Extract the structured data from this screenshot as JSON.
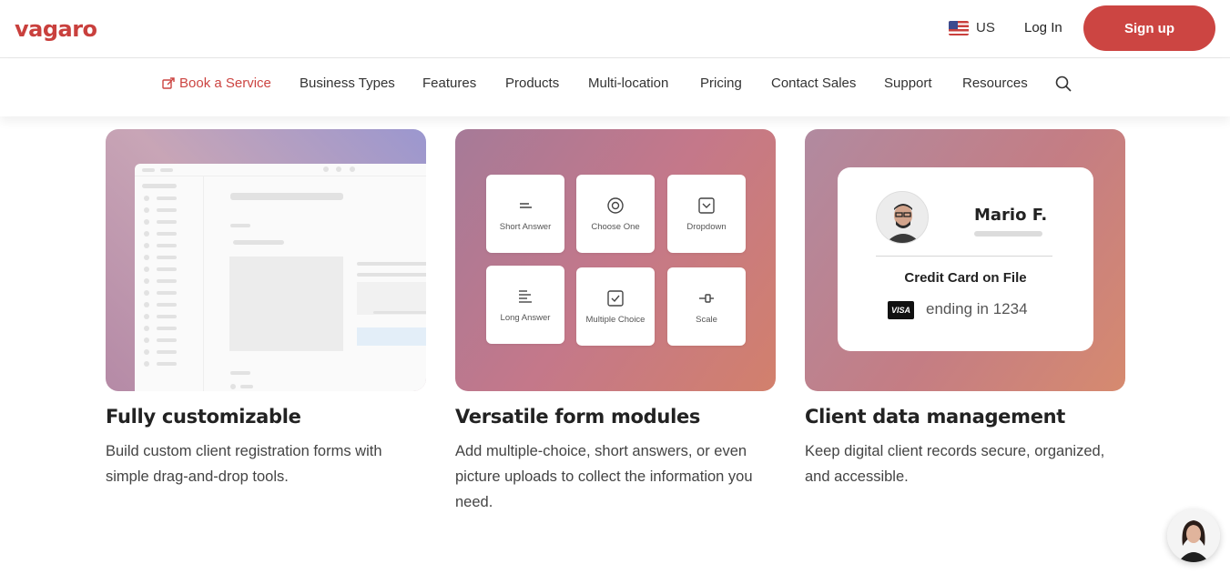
{
  "header": {
    "logo": "vagaro",
    "locale_label": "US",
    "login_label": "Log In",
    "signup_label": "Sign up"
  },
  "nav": {
    "items": [
      {
        "label": "Book a Service"
      },
      {
        "label": "Business Types"
      },
      {
        "label": "Features"
      },
      {
        "label": "Products"
      },
      {
        "label": "Multi-location"
      },
      {
        "label": "Pricing"
      },
      {
        "label": "Contact Sales"
      },
      {
        "label": "Support"
      },
      {
        "label": "Resources"
      }
    ]
  },
  "cards": [
    {
      "title": "Fully customizable",
      "description": "Build custom client registration forms with simple drag-and-drop tools."
    },
    {
      "title": "Versatile form modules",
      "description": "Add multiple-choice, short answers, or even picture uploads to collect the information you need.",
      "modules": [
        {
          "label": "Short Answer",
          "icon": "short-answer-icon"
        },
        {
          "label": "Choose One",
          "icon": "radio-icon"
        },
        {
          "label": "Dropdown",
          "icon": "dropdown-icon"
        },
        {
          "label": "Long Answer",
          "icon": "long-answer-icon"
        },
        {
          "label": "Multiple Choice",
          "icon": "checkbox-icon"
        },
        {
          "label": "Scale",
          "icon": "scale-icon"
        }
      ]
    },
    {
      "title": "Client data management",
      "description": "Keep digital client records secure, organized, and accessible.",
      "client": {
        "name": "Mario F.",
        "credit_label": "Credit Card on File",
        "card_brand": "VISA",
        "ending": "ending in 1234"
      }
    }
  ],
  "colors": {
    "brand": "#cc4542",
    "text": "#333333"
  }
}
